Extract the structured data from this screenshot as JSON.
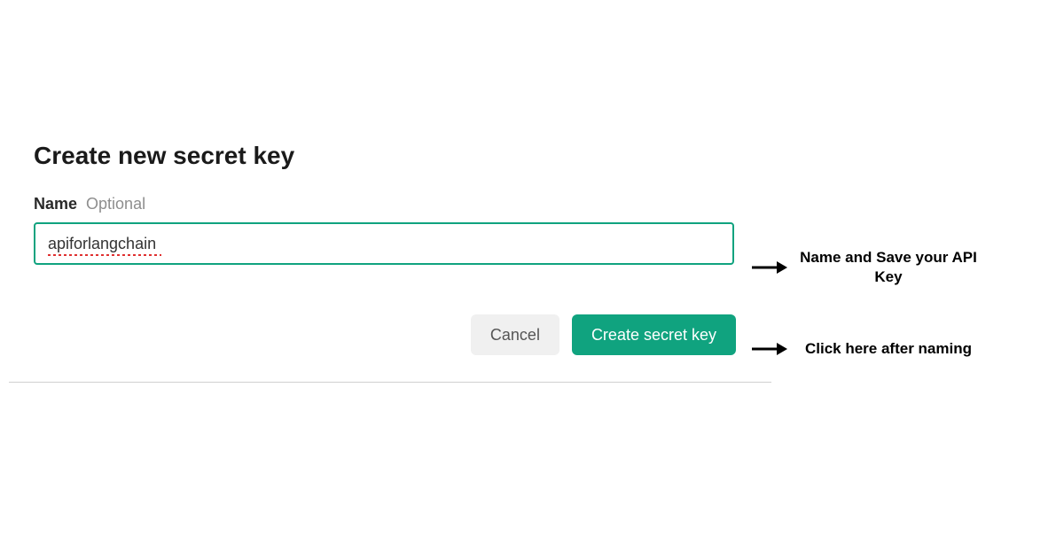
{
  "dialog": {
    "title": "Create new secret key",
    "field_label": "Name",
    "field_hint": "Optional",
    "name_value": "apiforlangchain",
    "cancel_label": "Cancel",
    "create_label": "Create secret key"
  },
  "annotations": {
    "input_note": "Name and Save your API Key",
    "button_note": "Click here after naming"
  },
  "colors": {
    "accent": "#10a37f"
  }
}
